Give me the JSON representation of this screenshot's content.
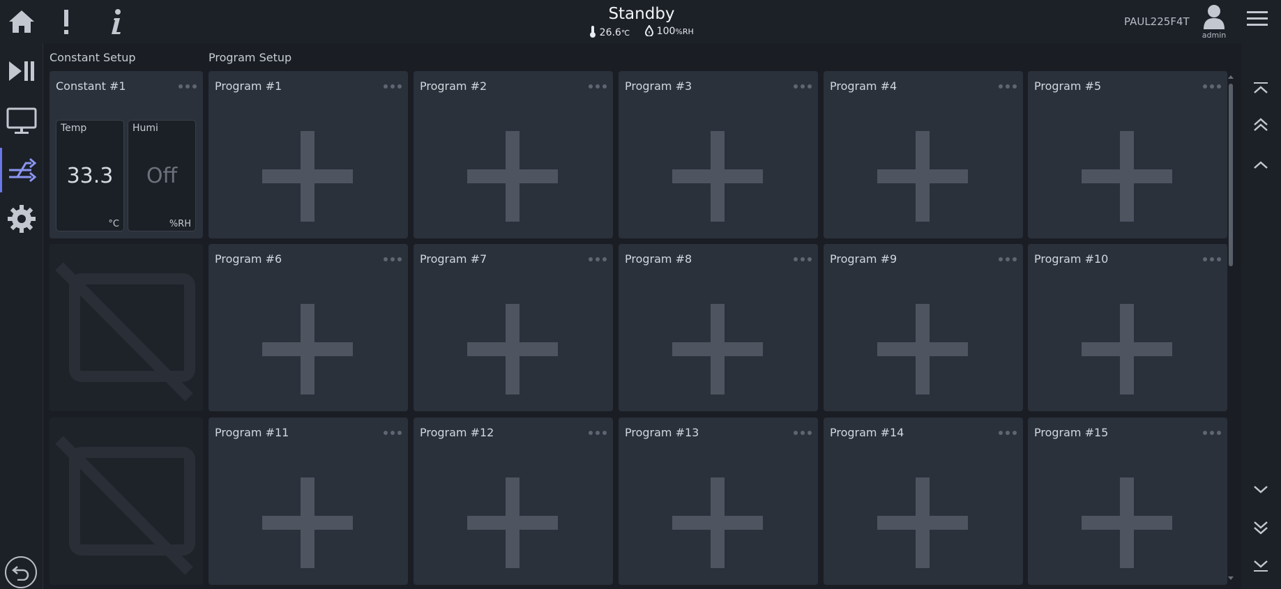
{
  "header": {
    "status": "Standby",
    "temperature": "26.6",
    "temp_unit": "℃",
    "humidity": "100",
    "humidity_unit": "%RH",
    "device_name": "PAUL225F4T",
    "user": "admin"
  },
  "sections": {
    "constant_label": "Constant Setup",
    "program_label": "Program Setup"
  },
  "constant": {
    "title": "Constant #1",
    "temp_label": "Temp",
    "temp_value": "33.3",
    "temp_unit": "°C",
    "humi_label": "Humi",
    "humi_value": "Off",
    "humi_unit": "%RH"
  },
  "programs": [
    "Program #1",
    "Program #2",
    "Program #3",
    "Program #4",
    "Program #5",
    "Program #6",
    "Program #7",
    "Program #8",
    "Program #9",
    "Program #10",
    "Program #11",
    "Program #12",
    "Program #13",
    "Program #14",
    "Program #15"
  ],
  "icons": {
    "home": "home-icon",
    "alarm": "exclamation-icon",
    "info": "info-icon",
    "run": "play-pause-icon",
    "monitor": "monitor-icon",
    "program": "program-shuffle-icon",
    "settings": "gear-icon",
    "back": "back-icon",
    "menu": "hamburger-icon",
    "user": "user-icon"
  },
  "colors": {
    "accent": "#6a78e8",
    "card": "#2b313b",
    "background": "#1a1e24"
  }
}
